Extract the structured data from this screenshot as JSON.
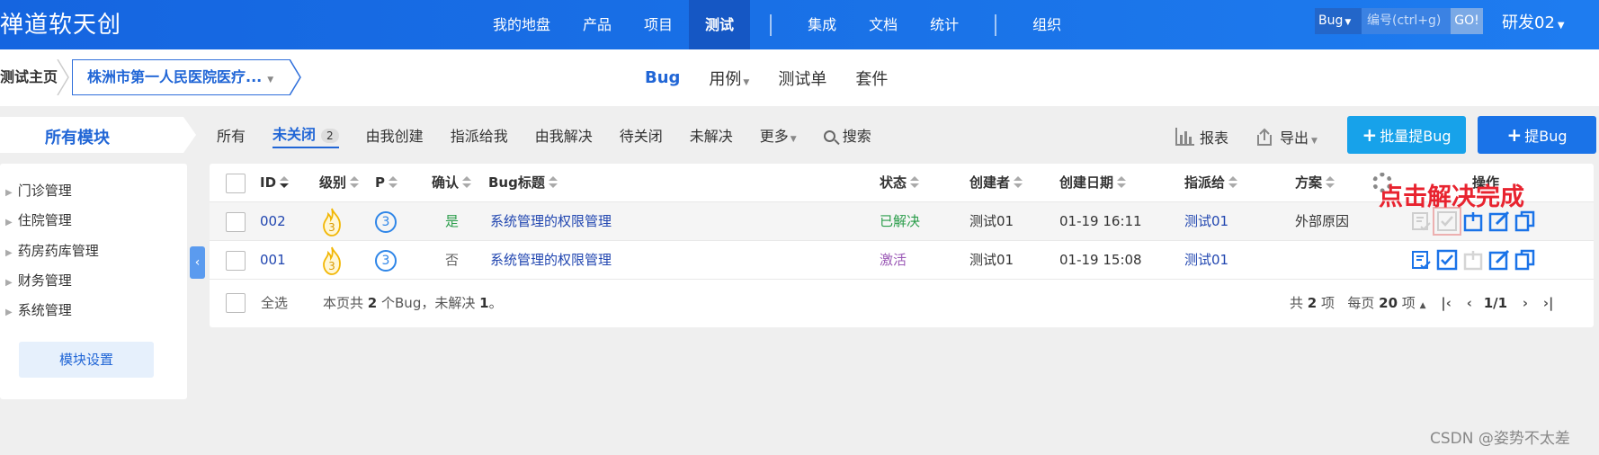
{
  "app": {
    "brand": "禅道软天创"
  },
  "mainnav": {
    "items": [
      {
        "label": "我的地盘"
      },
      {
        "label": "产品"
      },
      {
        "label": "项目"
      },
      {
        "label": "测试",
        "active": true
      },
      {
        "label": "集成"
      },
      {
        "label": "文档"
      },
      {
        "label": "统计"
      },
      {
        "label": "组织"
      }
    ]
  },
  "search": {
    "type": "Bug",
    "placeholder": "编号(ctrl+g)",
    "go": "GO!"
  },
  "user": {
    "name": "研发02"
  },
  "breadcrumb": {
    "home": "测试主页",
    "product": "株洲市第一人民医院医疗..."
  },
  "subnav": {
    "bug": "Bug",
    "case": "用例",
    "testtask": "测试单",
    "suite": "套件"
  },
  "modules": {
    "title": "所有模块",
    "items": [
      "门诊管理",
      "住院管理",
      "药房药库管理",
      "财务管理",
      "系统管理"
    ],
    "settings": "模块设置"
  },
  "filters": {
    "all": "所有",
    "unclosed": "未关闭",
    "unclosed_count": "2",
    "created_by_me": "由我创建",
    "assigned_to_me": "指派给我",
    "resolved_by_me": "由我解决",
    "to_close": "待关闭",
    "unresolved": "未解决",
    "more": "更多",
    "search": "搜索"
  },
  "tools": {
    "report": "报表",
    "export": "导出",
    "batch_create": "批量提Bug",
    "create": "提Bug"
  },
  "table": {
    "columns": {
      "id": "ID",
      "severity": "级别",
      "pri": "P",
      "confirmed": "确认",
      "title": "Bug标题",
      "status": "状态",
      "opened_by": "创建者",
      "opened_date": "创建日期",
      "assigned_to": "指派给",
      "resolution": "方案",
      "actions": "操作"
    },
    "rows": [
      {
        "id": "002",
        "severity": "3",
        "pri": "3",
        "confirmed": "是",
        "title": "系统管理的权限管理",
        "status": "已解决",
        "opened_by": "测试01",
        "opened_date": "01-19 16:11",
        "assigned_to": "测试01",
        "resolution": "外部原因"
      },
      {
        "id": "001",
        "severity": "3",
        "pri": "3",
        "confirmed": "否",
        "title": "系统管理的权限管理",
        "status": "激活",
        "opened_by": "测试01",
        "opened_date": "01-19 15:08",
        "assigned_to": "测试01",
        "resolution": ""
      }
    ],
    "footer": {
      "select_all": "全选",
      "summary_prefix": "本页共",
      "summary_count": "2",
      "summary_mid": "个Bug，未解决",
      "summary_unresolved": "1",
      "summary_suffix": "。",
      "total_prefix": "共",
      "total": "2",
      "total_suffix": "项",
      "per_page_prefix": "每页",
      "per_page": "20",
      "per_page_suffix": "项",
      "page": "1/1"
    }
  },
  "annotation": "点击解决完成",
  "watermark": "CSDN @姿势不太差",
  "colors": {
    "topbar": "#1a73e8",
    "accent": "#2166d6",
    "annotation": "#e8232f"
  }
}
